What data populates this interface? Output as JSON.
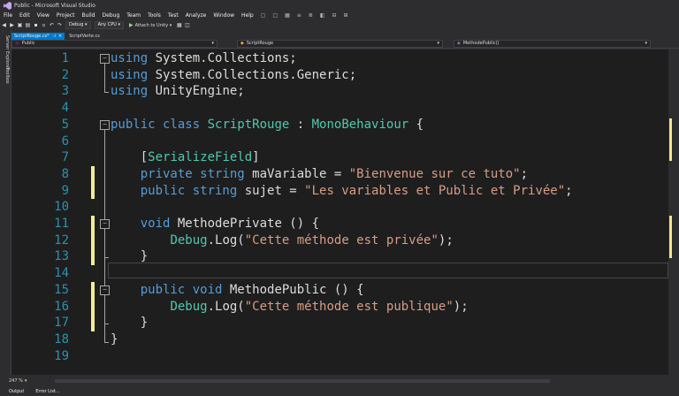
{
  "window": {
    "title": "Public - Microsoft Visual Studio"
  },
  "menu": [
    "File",
    "Edit",
    "View",
    "Project",
    "Build",
    "Debug",
    "Team",
    "Tools",
    "Test",
    "Analyze",
    "Window",
    "Help"
  ],
  "toolbar": {
    "config": "Debug",
    "platform": "Any CPU",
    "attach": "Attach to Unity"
  },
  "tabs": [
    {
      "label": "ScriptRouge.cs*",
      "active": true
    },
    {
      "label": "ScriptVerte.cs",
      "active": false
    }
  ],
  "navbar": {
    "project": "Public",
    "class": "ScriptRouge",
    "member": "MethodePublic()"
  },
  "sidebar": {
    "server_explorer": "Server Explorer",
    "toolbox": "Toolbox"
  },
  "editor": {
    "zoom": "247 %",
    "lines": [
      {
        "num": "1",
        "tokens": [
          {
            "t": "using",
            "c": "kw"
          },
          {
            "t": " System.Collections;",
            "c": "plain"
          }
        ]
      },
      {
        "num": "2",
        "tokens": [
          {
            "t": "using",
            "c": "kw"
          },
          {
            "t": " System.Collections.Generic;",
            "c": "plain"
          }
        ]
      },
      {
        "num": "3",
        "tokens": [
          {
            "t": "using",
            "c": "kw"
          },
          {
            "t": " UnityEngine;",
            "c": "plain"
          }
        ]
      },
      {
        "num": "4",
        "tokens": []
      },
      {
        "num": "5",
        "tokens": [
          {
            "t": "public class",
            "c": "kw"
          },
          {
            "t": " ",
            "c": "plain"
          },
          {
            "t": "ScriptRouge",
            "c": "type"
          },
          {
            "t": " : ",
            "c": "plain"
          },
          {
            "t": "MonoBehaviour",
            "c": "type"
          },
          {
            "t": " {",
            "c": "plain"
          }
        ]
      },
      {
        "num": "6",
        "tokens": []
      },
      {
        "num": "7",
        "tokens": [
          {
            "t": "    [",
            "c": "plain"
          },
          {
            "t": "SerializeField",
            "c": "attr"
          },
          {
            "t": "]",
            "c": "plain"
          }
        ]
      },
      {
        "num": "8",
        "tokens": [
          {
            "t": "    private string",
            "c": "kw"
          },
          {
            "t": " maVariable = ",
            "c": "plain"
          },
          {
            "t": "\"Bienvenue sur ce tuto\"",
            "c": "str"
          },
          {
            "t": ";",
            "c": "plain"
          }
        ]
      },
      {
        "num": "9",
        "tokens": [
          {
            "t": "    public string",
            "c": "kw"
          },
          {
            "t": " sujet = ",
            "c": "plain"
          },
          {
            "t": "\"Les variables et Public et Privée\"",
            "c": "str"
          },
          {
            "t": ";",
            "c": "plain"
          }
        ]
      },
      {
        "num": "10",
        "tokens": []
      },
      {
        "num": "11",
        "tokens": [
          {
            "t": "    void",
            "c": "kw"
          },
          {
            "t": " MethodePrivate () {",
            "c": "plain"
          }
        ]
      },
      {
        "num": "12",
        "tokens": [
          {
            "t": "        ",
            "c": "plain"
          },
          {
            "t": "Debug",
            "c": "type"
          },
          {
            "t": ".Log(",
            "c": "plain"
          },
          {
            "t": "\"Cette méthode est privée\"",
            "c": "str"
          },
          {
            "t": ");",
            "c": "plain"
          }
        ]
      },
      {
        "num": "13",
        "tokens": [
          {
            "t": "    }",
            "c": "plain"
          }
        ]
      },
      {
        "num": "14",
        "tokens": []
      },
      {
        "num": "15",
        "tokens": [
          {
            "t": "    public void",
            "c": "kw"
          },
          {
            "t": " MethodePublic () {",
            "c": "plain"
          }
        ]
      },
      {
        "num": "16",
        "tokens": [
          {
            "t": "        ",
            "c": "plain"
          },
          {
            "t": "Debug",
            "c": "type"
          },
          {
            "t": ".Log(",
            "c": "plain"
          },
          {
            "t": "\"Cette méthode est publique\"",
            "c": "str"
          },
          {
            "t": ");",
            "c": "plain"
          }
        ]
      },
      {
        "num": "17",
        "tokens": [
          {
            "t": "    }",
            "c": "plain"
          }
        ]
      },
      {
        "num": "18",
        "tokens": [
          {
            "t": "}",
            "c": "plain"
          }
        ]
      },
      {
        "num": "19",
        "tokens": []
      }
    ]
  },
  "bottom": {
    "output": "Output",
    "error_list": "Error List..."
  },
  "colors": {
    "keyword": "#569cd6",
    "type": "#4ec9b0",
    "string": "#d69d85",
    "line_number": "#2b91af",
    "change_marker": "#efef91",
    "accent": "#007acc"
  }
}
